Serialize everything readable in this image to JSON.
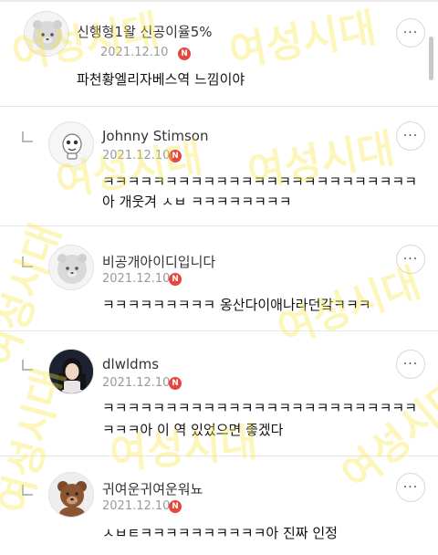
{
  "comments": [
    {
      "author": "신행형1왈 신공이율5%",
      "date": "2021.12.10",
      "badge": "N",
      "lines": [
        "파천황엘리자베스역 느낌이야"
      ],
      "avatar": "default-animal-avatar",
      "is_reply": false
    },
    {
      "author": "Johnny Stimson",
      "date": "2021.12.10",
      "badge": "N",
      "lines": [
        "ㅋㅋㅋㅋㅋㅋㅋㅋㅋㅋㅋㅋㅋㅋㅋㅋㅋㅋㅋㅋㅋㅋㅋㅋㅋ",
        "아 개웃겨 ㅅㅂ ㅋㅋㅋㅋㅋㅋㅋㅋ"
      ],
      "avatar": "cartoon-character-avatar",
      "is_reply": true
    },
    {
      "author": "비공개아이디입니다",
      "date": "2021.12.10",
      "badge": "N",
      "lines": [
        "ㅋㅋㅋㅋㅋㅋㅋㅋㅋ 옹산다이애나라던갘ㅋㅋㅋ"
      ],
      "avatar": "default-animal-avatar",
      "is_reply": true
    },
    {
      "author": "dlwldms",
      "date": "2021.12.10",
      "badge": "N",
      "lines": [
        "ㅋㅋㅋㅋㅋㅋㅋㅋㅋㅋㅋㅋㅋㅋㅋㅋㅋㅋㅋㅋㅋㅋㅋㅋㅋ",
        "ㅋㅋㅋ아 이 역 있었으면 좋겠다"
      ],
      "avatar": "person-photo-avatar",
      "is_reply": true
    },
    {
      "author": "귀여운귀여운워뇨",
      "date": "2021.12.10",
      "badge": "N",
      "lines": [
        "ㅅㅂㅌㅋㅋㅋㅋㅋㅋㅋㅋㅋㅋ아 진짜 인정"
      ],
      "avatar": "teddy-bear-avatar",
      "is_reply": true
    }
  ],
  "more_button_label": "···",
  "watermark_text": "여성시대"
}
